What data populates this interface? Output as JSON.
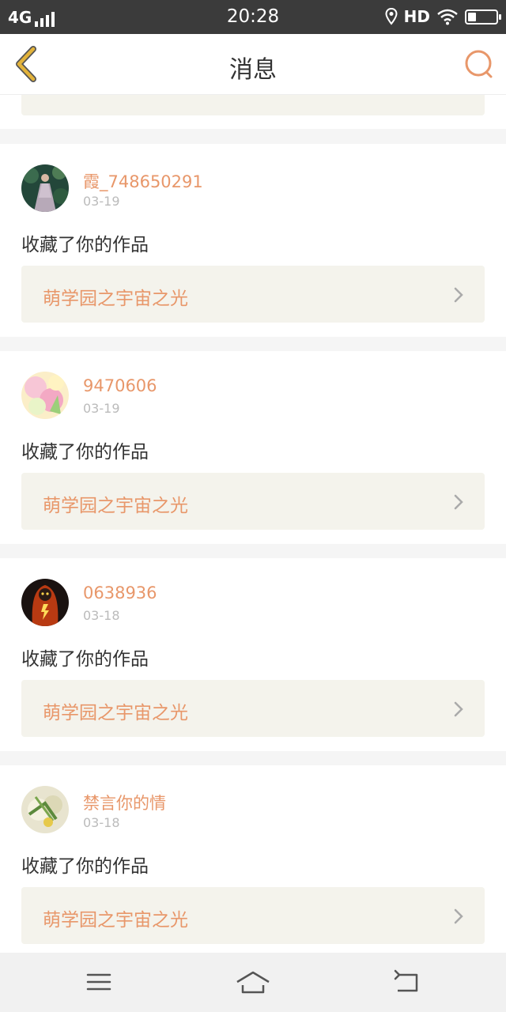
{
  "status": {
    "network": "4G",
    "time": "20:28",
    "hd_label": "HD",
    "battery_level": 0.3,
    "icons": [
      "signal-icon",
      "location-icon",
      "wifi-icon",
      "battery-icon"
    ]
  },
  "header": {
    "title": "消息",
    "back_icon": "chevron-left-icon",
    "search_icon": "search-icon"
  },
  "colors": {
    "accent": "#e8976a",
    "back_arrow": "#e3b33a",
    "link_bg": "#f4f3ec",
    "status_bar": "#3b3b3b"
  },
  "messages": [
    {
      "user": "霞_748650291",
      "date": "03-19",
      "action": "收藏了你的作品",
      "work": "萌学园之宇宙之光"
    },
    {
      "user": "9470606",
      "date": "03-19",
      "action": "收藏了你的作品",
      "work": "萌学园之宇宙之光"
    },
    {
      "user": "0638936",
      "date": "03-18",
      "action": "收藏了你的作品",
      "work": "萌学园之宇宙之光"
    },
    {
      "user": "禁言你的情",
      "date": "03-18",
      "action": "收藏了你的作品",
      "work": "萌学园之宇宙之光"
    }
  ],
  "system_nav": [
    "menu-icon",
    "home-icon",
    "back-icon"
  ]
}
